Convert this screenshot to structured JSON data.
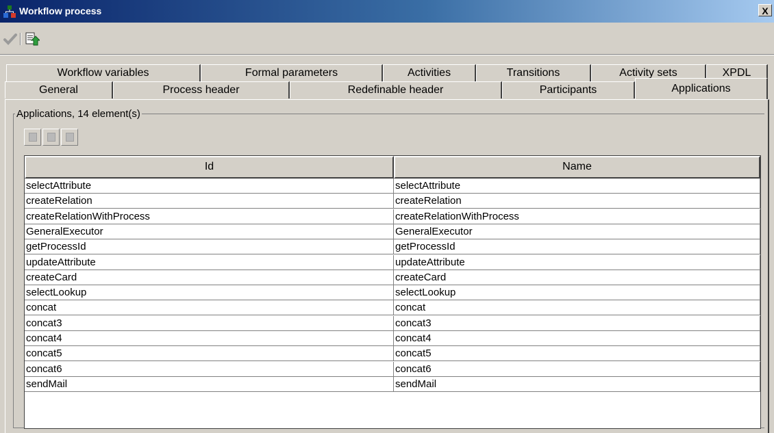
{
  "window": {
    "title": "Workflow process",
    "close_label": "X"
  },
  "toolbar": {
    "icons": [
      "checkmark-icon",
      "export-document-icon"
    ]
  },
  "tabs": {
    "row1": [
      "Workflow variables",
      "Formal parameters",
      "Activities",
      "Transitions",
      "Activity sets",
      "XPDL"
    ],
    "row2": [
      "General",
      "Process header",
      "Redefinable header",
      "Participants",
      "Applications"
    ],
    "active": "Applications"
  },
  "group": {
    "label": "Applications, 14 element(s)"
  },
  "table": {
    "columns": [
      "Id",
      "Name"
    ],
    "rows": [
      [
        "selectAttribute",
        "selectAttribute"
      ],
      [
        "createRelation",
        "createRelation"
      ],
      [
        "createRelationWithProcess",
        "createRelationWithProcess"
      ],
      [
        "GeneralExecutor",
        "GeneralExecutor"
      ],
      [
        "getProcessId",
        "getProcessId"
      ],
      [
        "updateAttribute",
        "updateAttribute"
      ],
      [
        "createCard",
        "createCard"
      ],
      [
        "selectLookup",
        "selectLookup"
      ],
      [
        "concat",
        "concat"
      ],
      [
        "concat3",
        "concat3"
      ],
      [
        "concat4",
        "concat4"
      ],
      [
        "concat5",
        "concat5"
      ],
      [
        "concat6",
        "concat6"
      ],
      [
        "sendMail",
        "sendMail"
      ]
    ]
  }
}
